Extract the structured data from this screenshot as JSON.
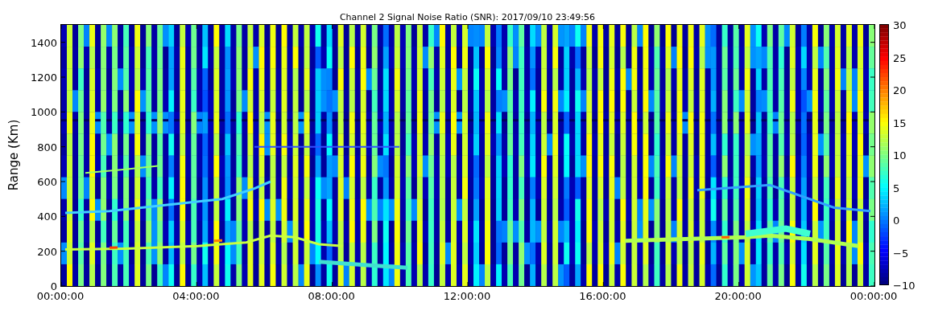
{
  "title": "Channel 2 Signal Noise Ratio (SNR): 2017/09/10 23:49:56",
  "y_axis": {
    "label": "Range (Km)",
    "ticks": [
      "1400",
      "1200",
      "1000",
      "800",
      "600",
      "400",
      "200",
      "0"
    ]
  },
  "x_axis": {
    "ticks": [
      "00:00:00",
      "04:00:00",
      "08:00:00",
      "12:00:00",
      "16:00:00",
      "20:00:00",
      "00:00:00"
    ]
  },
  "colorbar": {
    "ticks": [
      "30",
      "25",
      "20",
      "15",
      "10",
      "5",
      "0",
      "−5",
      "−10"
    ]
  }
}
